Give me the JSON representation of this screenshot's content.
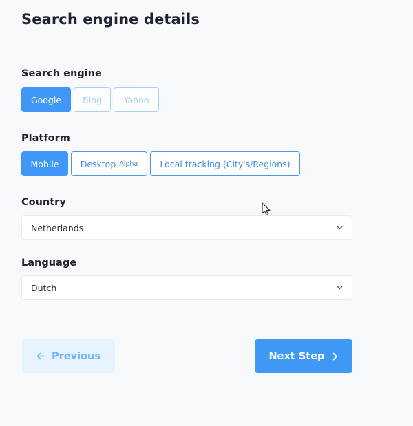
{
  "page": {
    "title": "Search engine details"
  },
  "search_engine": {
    "label": "Search engine",
    "options": [
      "Google",
      "Bing",
      "Yahoo"
    ],
    "selected": "Google"
  },
  "platform": {
    "label": "Platform",
    "options": [
      "Mobile",
      "Desktop",
      "Local tracking (City's/Regions)"
    ],
    "desktop_badge": "Alpha",
    "selected": "Mobile"
  },
  "country": {
    "label": "Country",
    "value": "Netherlands"
  },
  "language": {
    "label": "Language",
    "value": "Dutch"
  },
  "nav": {
    "previous_label": "Previous",
    "next_label": "Next Step"
  },
  "icons": {
    "dropdown": "chevron-down-icon",
    "previous": "arrow-left-icon",
    "next": "chevron-right-icon",
    "cursor": "mouse-pointer-icon"
  },
  "colors": {
    "accent": "#4097f5",
    "accent_faded": "#a9d0f8",
    "prev_bg": "#e6f2fe"
  }
}
